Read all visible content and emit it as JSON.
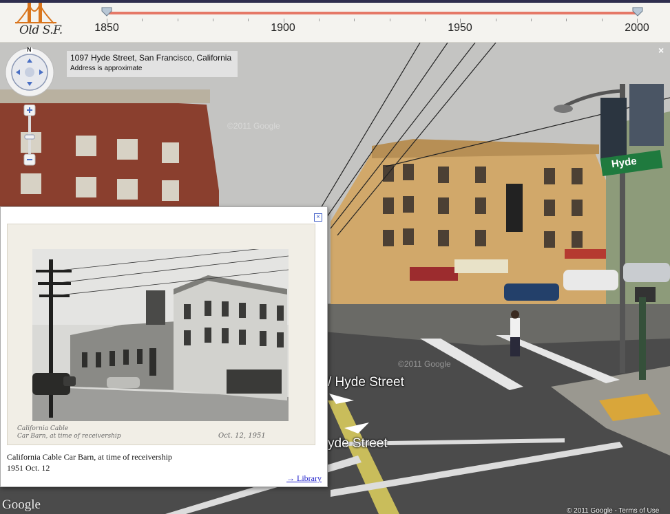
{
  "header": {
    "logo_text": "Old S.F.",
    "timeline": {
      "years": [
        "1850",
        "1900",
        "1950",
        "2000"
      ],
      "range_start": 1850,
      "range_end": 2000
    }
  },
  "streetview": {
    "address": "1097 Hyde Street, San Francisco, California",
    "address_note": "Address is approximate",
    "compass_label": "N",
    "street_label_1": "/ Hyde Street",
    "street_label_2": "yde Street",
    "street_sign": "Hyde",
    "watermark": "©2011 Google",
    "close": "×",
    "google_logo": "Google",
    "copyright": "© 2011 Google - Terms of Use"
  },
  "popup": {
    "close": "×",
    "caption_title": "California Cable Car Barn, at time of receivership",
    "caption_date": "1951 Oct. 12",
    "handwritten_note": "California Cable\nCar Barn, at time of receivership",
    "handwritten_date": "Oct. 12, 1951",
    "link": "→ Library"
  },
  "colors": {
    "accent": "#e57867",
    "link": "#2222cc",
    "header_bg": "#f4f3ef"
  }
}
